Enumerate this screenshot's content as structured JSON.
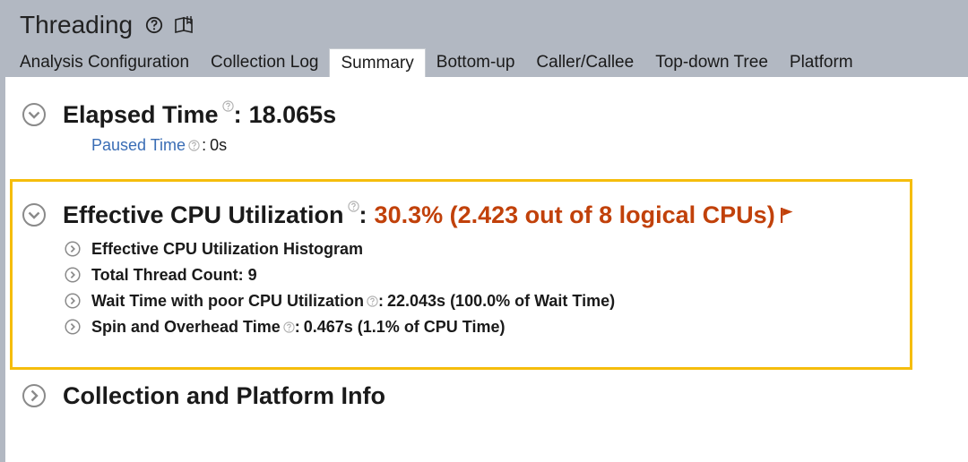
{
  "header": {
    "title": "Threading",
    "help_icon": "help-circle-icon",
    "book_icon": "book-icon"
  },
  "tabs": [
    {
      "label": "Analysis Configuration",
      "active": false
    },
    {
      "label": "Collection Log",
      "active": false
    },
    {
      "label": "Summary",
      "active": true
    },
    {
      "label": "Bottom-up",
      "active": false
    },
    {
      "label": "Caller/Callee",
      "active": false
    },
    {
      "label": "Top-down Tree",
      "active": false
    },
    {
      "label": "Platform",
      "active": false
    }
  ],
  "elapsed": {
    "label": "Elapsed Time",
    "colon": ":",
    "value": "18.065s",
    "paused_label": "Paused Time",
    "paused_colon": ":",
    "paused_value": "0s"
  },
  "cpu": {
    "label": "Effective CPU Utilization",
    "colon": ":",
    "value": "30.3% (2.423 out of 8 logical CPUs)",
    "value_color": "#c1410a",
    "items": [
      {
        "label": "Effective CPU Utilization Histogram",
        "colon": "",
        "value": ""
      },
      {
        "label": "Total Thread Count: 9",
        "colon": "",
        "value": ""
      },
      {
        "label": "Wait Time with poor CPU Utilization",
        "colon": ":",
        "value": "22.043s (100.0% of Wait Time)"
      },
      {
        "label": "Spin and Overhead Time",
        "colon": ":",
        "value": "0.467s (1.1% of CPU Time)"
      }
    ]
  },
  "platform": {
    "label": "Collection and Platform Info"
  },
  "colors": {
    "header_bg": "#b2b8c2",
    "highlight_border": "#f5bd0c",
    "link": "#3a6db5"
  }
}
